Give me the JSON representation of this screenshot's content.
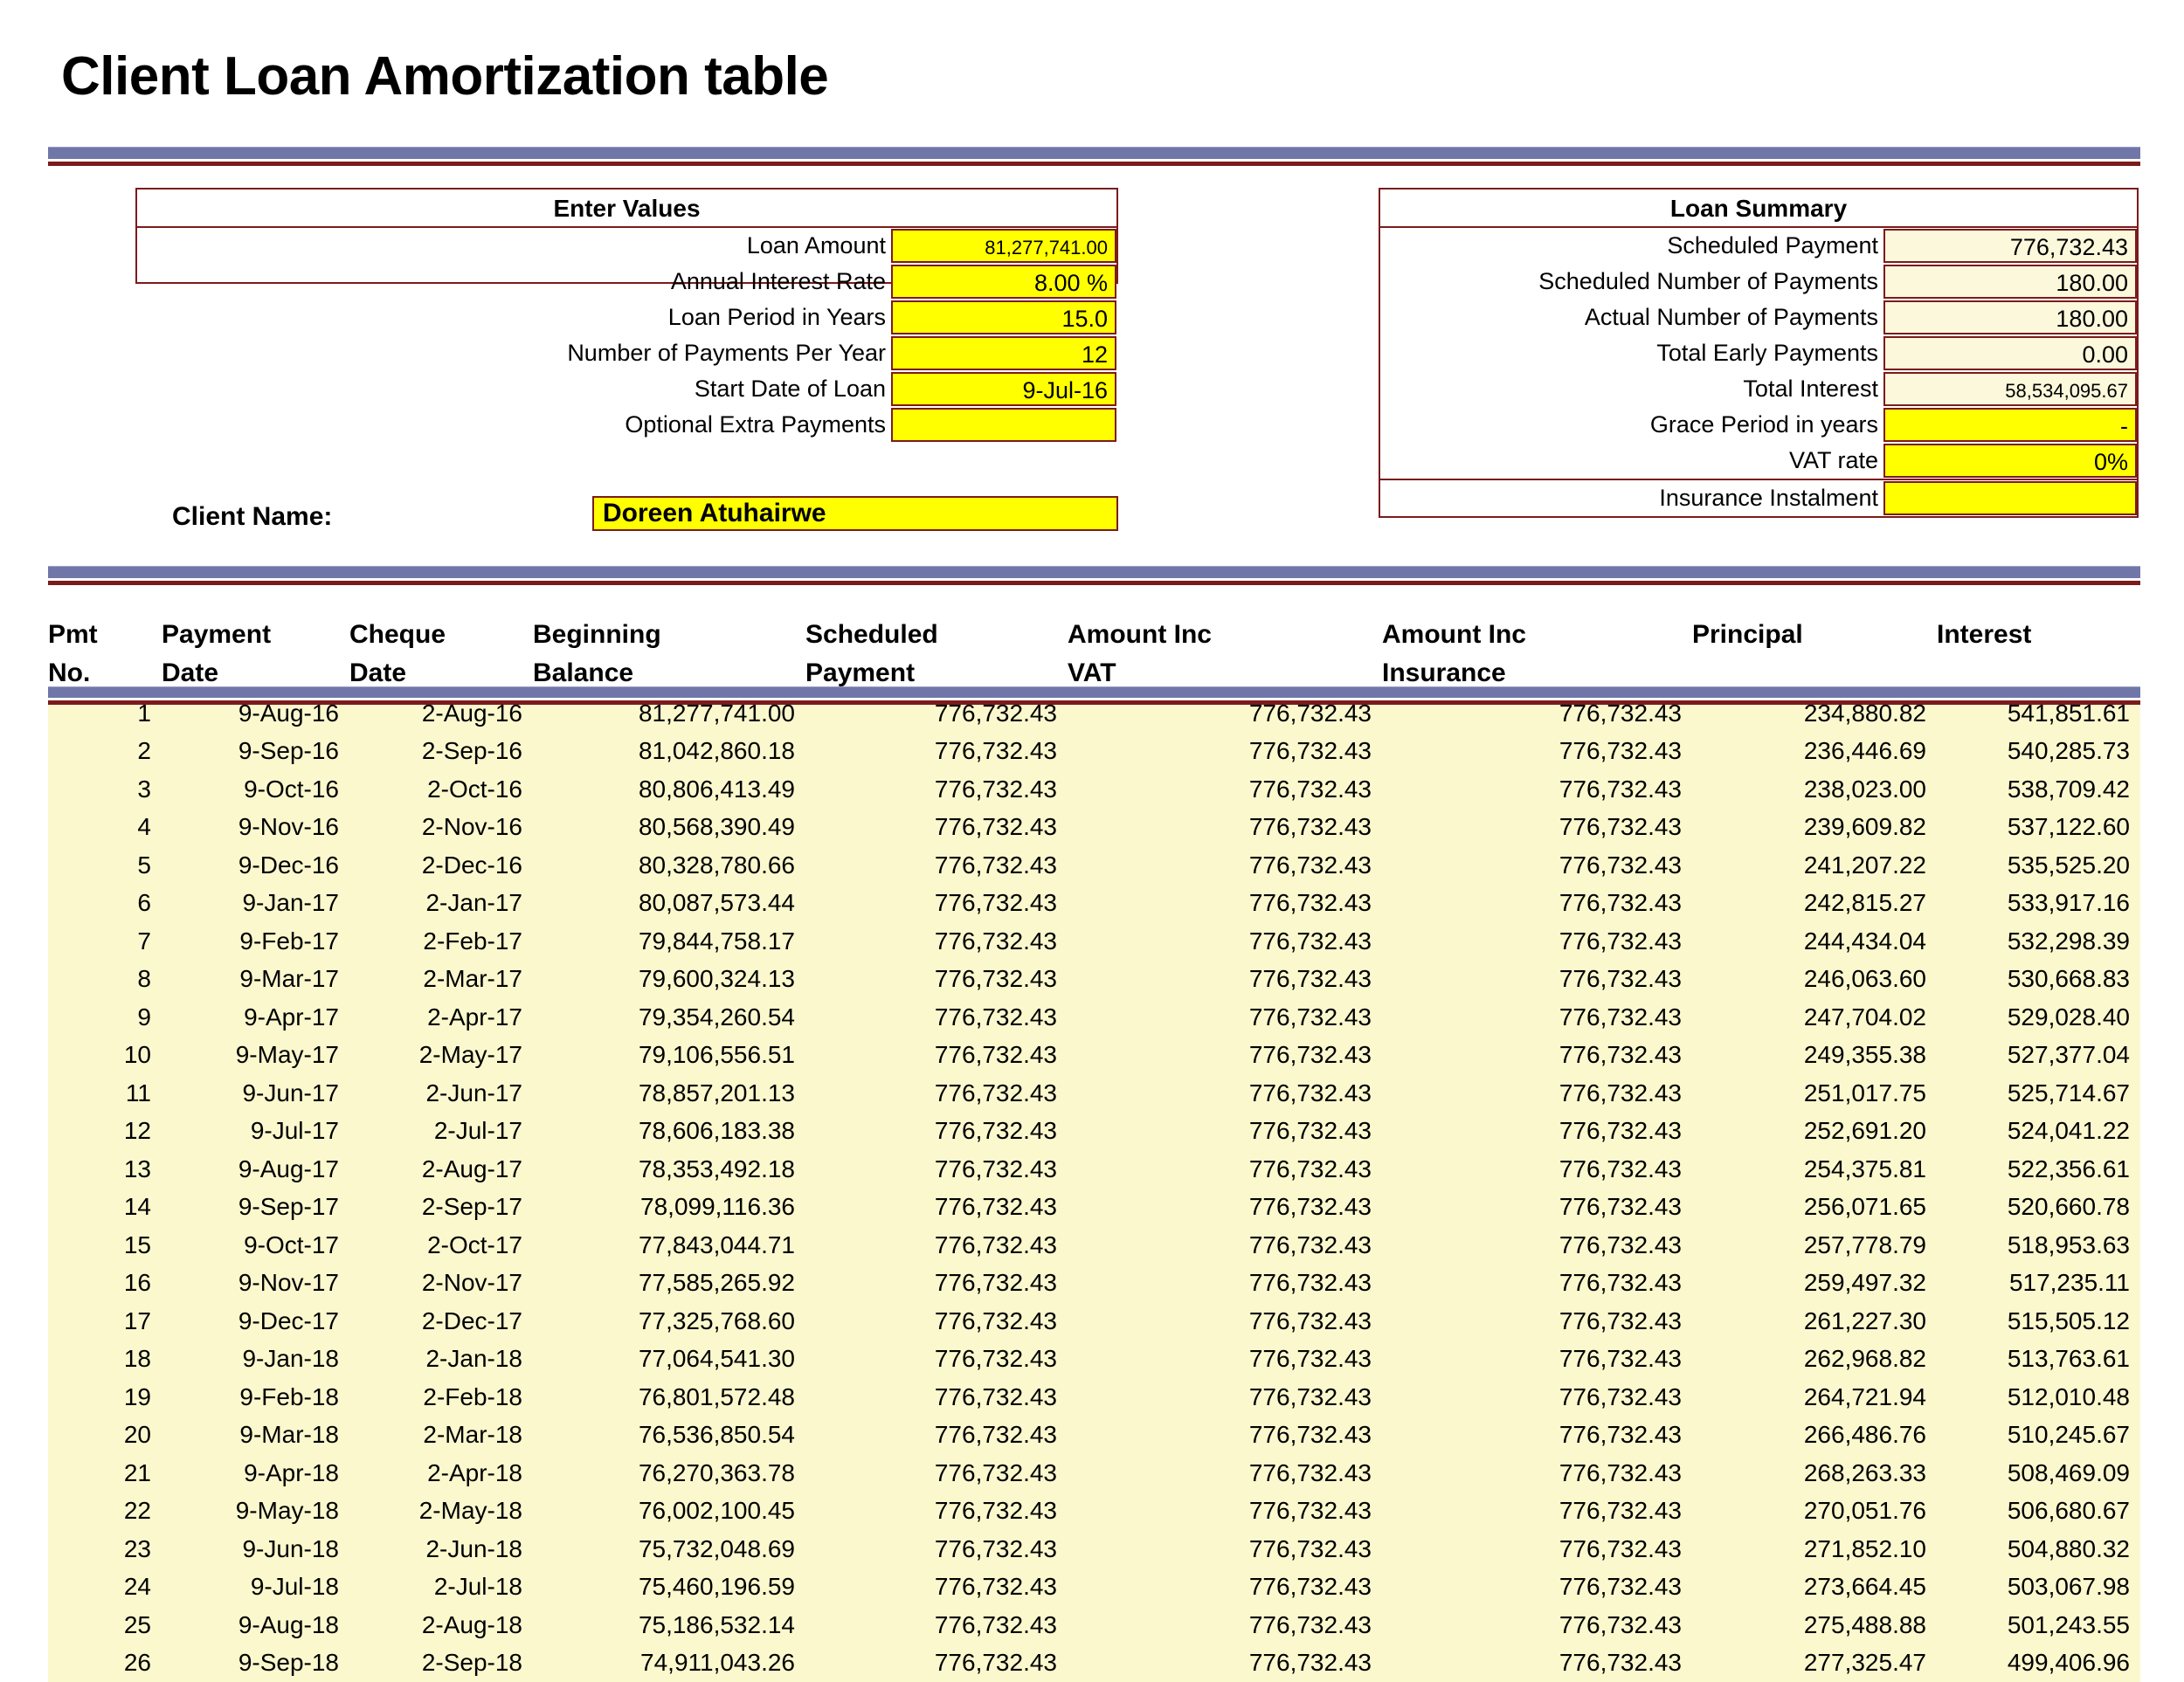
{
  "page_title": "Client Loan Amortization table",
  "enter_values": {
    "title": "Enter Values",
    "rows": [
      {
        "label": "Loan Amount",
        "value": "81,277,741.00",
        "style": "yellow small"
      },
      {
        "label": "Annual Interest Rate",
        "value": "8.00  %",
        "style": "yellow"
      },
      {
        "label": "Loan Period in Years",
        "value": "15.0",
        "style": "yellow"
      },
      {
        "label": "Number of Payments Per Year",
        "value": "12",
        "style": "yellow"
      },
      {
        "label": "Start Date of Loan",
        "value": "9-Jul-16",
        "style": "yellow"
      },
      {
        "label": "Optional Extra Payments",
        "value": "",
        "style": "yellow"
      }
    ]
  },
  "loan_summary": {
    "title": "Loan Summary",
    "rows": [
      {
        "label": "Scheduled Payment",
        "value": "776,732.43",
        "style": "cream"
      },
      {
        "label": "Scheduled Number of Payments",
        "value": "180.00",
        "style": "cream"
      },
      {
        "label": "Actual Number of Payments",
        "value": "180.00",
        "style": "cream"
      },
      {
        "label": "Total Early Payments",
        "value": "0.00",
        "style": "cream"
      },
      {
        "label": "Total Interest",
        "value": "58,534,095.67",
        "style": "cream small"
      },
      {
        "label": "Grace Period in years",
        "value": "-",
        "style": "yellow"
      },
      {
        "label": "VAT rate",
        "value": "0%",
        "style": "yellow"
      },
      {
        "label": "Insurance Instalment",
        "value": "",
        "style": "yellow"
      }
    ]
  },
  "client": {
    "label": "Client Name:",
    "name": "Doreen Atuhairwe"
  },
  "table": {
    "columns": [
      {
        "line1": "Pmt",
        "line2": "No."
      },
      {
        "line1": "Payment",
        "line2": "Date"
      },
      {
        "line1": "Cheque",
        "line2": "Date"
      },
      {
        "line1": "Beginning",
        "line2": "Balance"
      },
      {
        "line1": "Scheduled",
        "line2": "Payment"
      },
      {
        "line1": "Amount Inc",
        "line2": "VAT"
      },
      {
        "line1": "Amount Inc",
        "line2": "Insurance"
      },
      {
        "line1": "",
        "line2": "Principal"
      },
      {
        "line1": "",
        "line2": "Interest"
      }
    ],
    "rows": [
      [
        "1",
        "9-Aug-16",
        "2-Aug-16",
        "81,277,741.00",
        "776,732.43",
        "776,732.43",
        "776,732.43",
        "234,880.82",
        "541,851.61"
      ],
      [
        "2",
        "9-Sep-16",
        "2-Sep-16",
        "81,042,860.18",
        "776,732.43",
        "776,732.43",
        "776,732.43",
        "236,446.69",
        "540,285.73"
      ],
      [
        "3",
        "9-Oct-16",
        "2-Oct-16",
        "80,806,413.49",
        "776,732.43",
        "776,732.43",
        "776,732.43",
        "238,023.00",
        "538,709.42"
      ],
      [
        "4",
        "9-Nov-16",
        "2-Nov-16",
        "80,568,390.49",
        "776,732.43",
        "776,732.43",
        "776,732.43",
        "239,609.82",
        "537,122.60"
      ],
      [
        "5",
        "9-Dec-16",
        "2-Dec-16",
        "80,328,780.66",
        "776,732.43",
        "776,732.43",
        "776,732.43",
        "241,207.22",
        "535,525.20"
      ],
      [
        "6",
        "9-Jan-17",
        "2-Jan-17",
        "80,087,573.44",
        "776,732.43",
        "776,732.43",
        "776,732.43",
        "242,815.27",
        "533,917.16"
      ],
      [
        "7",
        "9-Feb-17",
        "2-Feb-17",
        "79,844,758.17",
        "776,732.43",
        "776,732.43",
        "776,732.43",
        "244,434.04",
        "532,298.39"
      ],
      [
        "8",
        "9-Mar-17",
        "2-Mar-17",
        "79,600,324.13",
        "776,732.43",
        "776,732.43",
        "776,732.43",
        "246,063.60",
        "530,668.83"
      ],
      [
        "9",
        "9-Apr-17",
        "2-Apr-17",
        "79,354,260.54",
        "776,732.43",
        "776,732.43",
        "776,732.43",
        "247,704.02",
        "529,028.40"
      ],
      [
        "10",
        "9-May-17",
        "2-May-17",
        "79,106,556.51",
        "776,732.43",
        "776,732.43",
        "776,732.43",
        "249,355.38",
        "527,377.04"
      ],
      [
        "11",
        "9-Jun-17",
        "2-Jun-17",
        "78,857,201.13",
        "776,732.43",
        "776,732.43",
        "776,732.43",
        "251,017.75",
        "525,714.67"
      ],
      [
        "12",
        "9-Jul-17",
        "2-Jul-17",
        "78,606,183.38",
        "776,732.43",
        "776,732.43",
        "776,732.43",
        "252,691.20",
        "524,041.22"
      ],
      [
        "13",
        "9-Aug-17",
        "2-Aug-17",
        "78,353,492.18",
        "776,732.43",
        "776,732.43",
        "776,732.43",
        "254,375.81",
        "522,356.61"
      ],
      [
        "14",
        "9-Sep-17",
        "2-Sep-17",
        "78,099,116.36",
        "776,732.43",
        "776,732.43",
        "776,732.43",
        "256,071.65",
        "520,660.78"
      ],
      [
        "15",
        "9-Oct-17",
        "2-Oct-17",
        "77,843,044.71",
        "776,732.43",
        "776,732.43",
        "776,732.43",
        "257,778.79",
        "518,953.63"
      ],
      [
        "16",
        "9-Nov-17",
        "2-Nov-17",
        "77,585,265.92",
        "776,732.43",
        "776,732.43",
        "776,732.43",
        "259,497.32",
        "517,235.11"
      ],
      [
        "17",
        "9-Dec-17",
        "2-Dec-17",
        "77,325,768.60",
        "776,732.43",
        "776,732.43",
        "776,732.43",
        "261,227.30",
        "515,505.12"
      ],
      [
        "18",
        "9-Jan-18",
        "2-Jan-18",
        "77,064,541.30",
        "776,732.43",
        "776,732.43",
        "776,732.43",
        "262,968.82",
        "513,763.61"
      ],
      [
        "19",
        "9-Feb-18",
        "2-Feb-18",
        "76,801,572.48",
        "776,732.43",
        "776,732.43",
        "776,732.43",
        "264,721.94",
        "512,010.48"
      ],
      [
        "20",
        "9-Mar-18",
        "2-Mar-18",
        "76,536,850.54",
        "776,732.43",
        "776,732.43",
        "776,732.43",
        "266,486.76",
        "510,245.67"
      ],
      [
        "21",
        "9-Apr-18",
        "2-Apr-18",
        "76,270,363.78",
        "776,732.43",
        "776,732.43",
        "776,732.43",
        "268,263.33",
        "508,469.09"
      ],
      [
        "22",
        "9-May-18",
        "2-May-18",
        "76,002,100.45",
        "776,732.43",
        "776,732.43",
        "776,732.43",
        "270,051.76",
        "506,680.67"
      ],
      [
        "23",
        "9-Jun-18",
        "2-Jun-18",
        "75,732,048.69",
        "776,732.43",
        "776,732.43",
        "776,732.43",
        "271,852.10",
        "504,880.32"
      ],
      [
        "24",
        "9-Jul-18",
        "2-Jul-18",
        "75,460,196.59",
        "776,732.43",
        "776,732.43",
        "776,732.43",
        "273,664.45",
        "503,067.98"
      ],
      [
        "25",
        "9-Aug-18",
        "2-Aug-18",
        "75,186,532.14",
        "776,732.43",
        "776,732.43",
        "776,732.43",
        "275,488.88",
        "501,243.55"
      ],
      [
        "26",
        "9-Sep-18",
        "2-Sep-18",
        "74,911,043.26",
        "776,732.43",
        "776,732.43",
        "776,732.43",
        "277,325.47",
        "499,406.96"
      ]
    ]
  },
  "colors": {
    "accent_bar": "#7077a8",
    "border_red": "#7b1b1b",
    "input_yellow": "#ffff00",
    "output_cream": "#fbf8dc",
    "row_cream": "#fbf8ce"
  }
}
